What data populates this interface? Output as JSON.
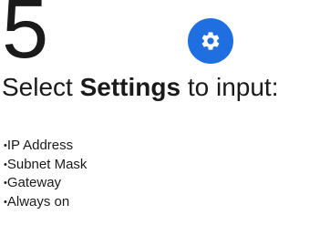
{
  "step": {
    "number": "5"
  },
  "icon": {
    "name": "gear-icon",
    "badge_color": "#1f6fe0",
    "glyph_color": "#ffffff"
  },
  "instruction": {
    "prefix": "Select ",
    "emphasis": "Settings",
    "suffix": " to input:"
  },
  "bullet_marker": "•",
  "items": [
    {
      "label": "IP Address"
    },
    {
      "label": "Subnet Mask"
    },
    {
      "label": "Gateway"
    },
    {
      "label": "Always on"
    }
  ]
}
